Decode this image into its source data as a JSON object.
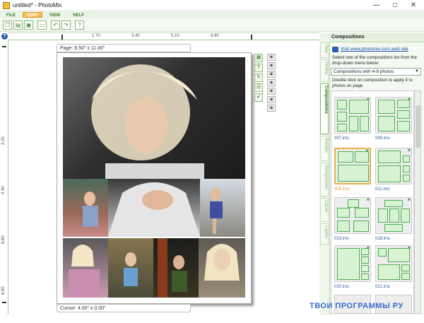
{
  "window": {
    "title": "untitled* - PhotoMix",
    "minimize": "—",
    "maximize": "□",
    "close": "✕"
  },
  "menu": [
    {
      "label": "FILE",
      "active": false
    },
    {
      "label": "EDIT",
      "active": true
    },
    {
      "label": "VIEW",
      "active": false
    },
    {
      "label": "HELP",
      "active": false
    }
  ],
  "toolbar": {
    "buttons": [
      {
        "name": "new-icon",
        "glyph": "❐"
      },
      {
        "name": "open-icon",
        "glyph": "▤"
      },
      {
        "name": "save-icon",
        "glyph": "▣"
      },
      {
        "name": "frame-icon",
        "glyph": "▭"
      },
      {
        "name": "undo-icon",
        "glyph": "↶"
      },
      {
        "name": "redo-icon",
        "glyph": "↷"
      },
      {
        "name": "help-icon",
        "glyph": "?"
      }
    ]
  },
  "ruler": {
    "h_labels": [
      "1.70",
      "3.40",
      "5.10",
      "6.80"
    ],
    "v_labels": [
      "2.20",
      "4.40",
      "6.60",
      "8.80"
    ],
    "help": "?"
  },
  "page": {
    "size_label": "Page: 8.50\" x 11.00\"",
    "cursor_label": "Cursor: 4.00\" x 0.00\""
  },
  "tools_primary": [
    "▦",
    "T",
    "✎",
    "☰",
    "✔"
  ],
  "tools_secondary": [
    "▣",
    "▣",
    "▣",
    "▣",
    "▣",
    "▣",
    "▣"
  ],
  "side_tabs": [
    {
      "label": "Help",
      "active": false
    },
    {
      "label": "Photos",
      "active": false
    },
    {
      "label": "Compositions",
      "active": true
    },
    {
      "label": "Borders",
      "active": false
    },
    {
      "label": "Backgrounds",
      "active": false
    },
    {
      "label": "Clipart",
      "active": false
    },
    {
      "label": "Layers",
      "active": false
    }
  ],
  "panel": {
    "title": "Compositions",
    "link": "Visit www.photomix.com web site",
    "instruction1": "Select one of the compositions list from the drop-down menu below",
    "select_value": "Compositions with 4-8 photos",
    "instruction2": "Double click on composition to apply it to photos on page",
    "help": "?"
  },
  "thumbnails": [
    {
      "label": "007.ims",
      "selected": false
    },
    {
      "label": "008.ims",
      "selected": false
    },
    {
      "label": "009.ims",
      "selected": true
    },
    {
      "label": "011.ims",
      "selected": false
    },
    {
      "label": "013.ims",
      "selected": false
    },
    {
      "label": "018.ims",
      "selected": false
    },
    {
      "label": "020.ims",
      "selected": false
    },
    {
      "label": "021.ims",
      "selected": false
    }
  ],
  "watermark": "ТВОИ ПРОГРАММЫ РУ",
  "colors": {
    "accent": "#4caf50",
    "menu_active": "#f5c15a",
    "link": "#1a4fb5"
  }
}
